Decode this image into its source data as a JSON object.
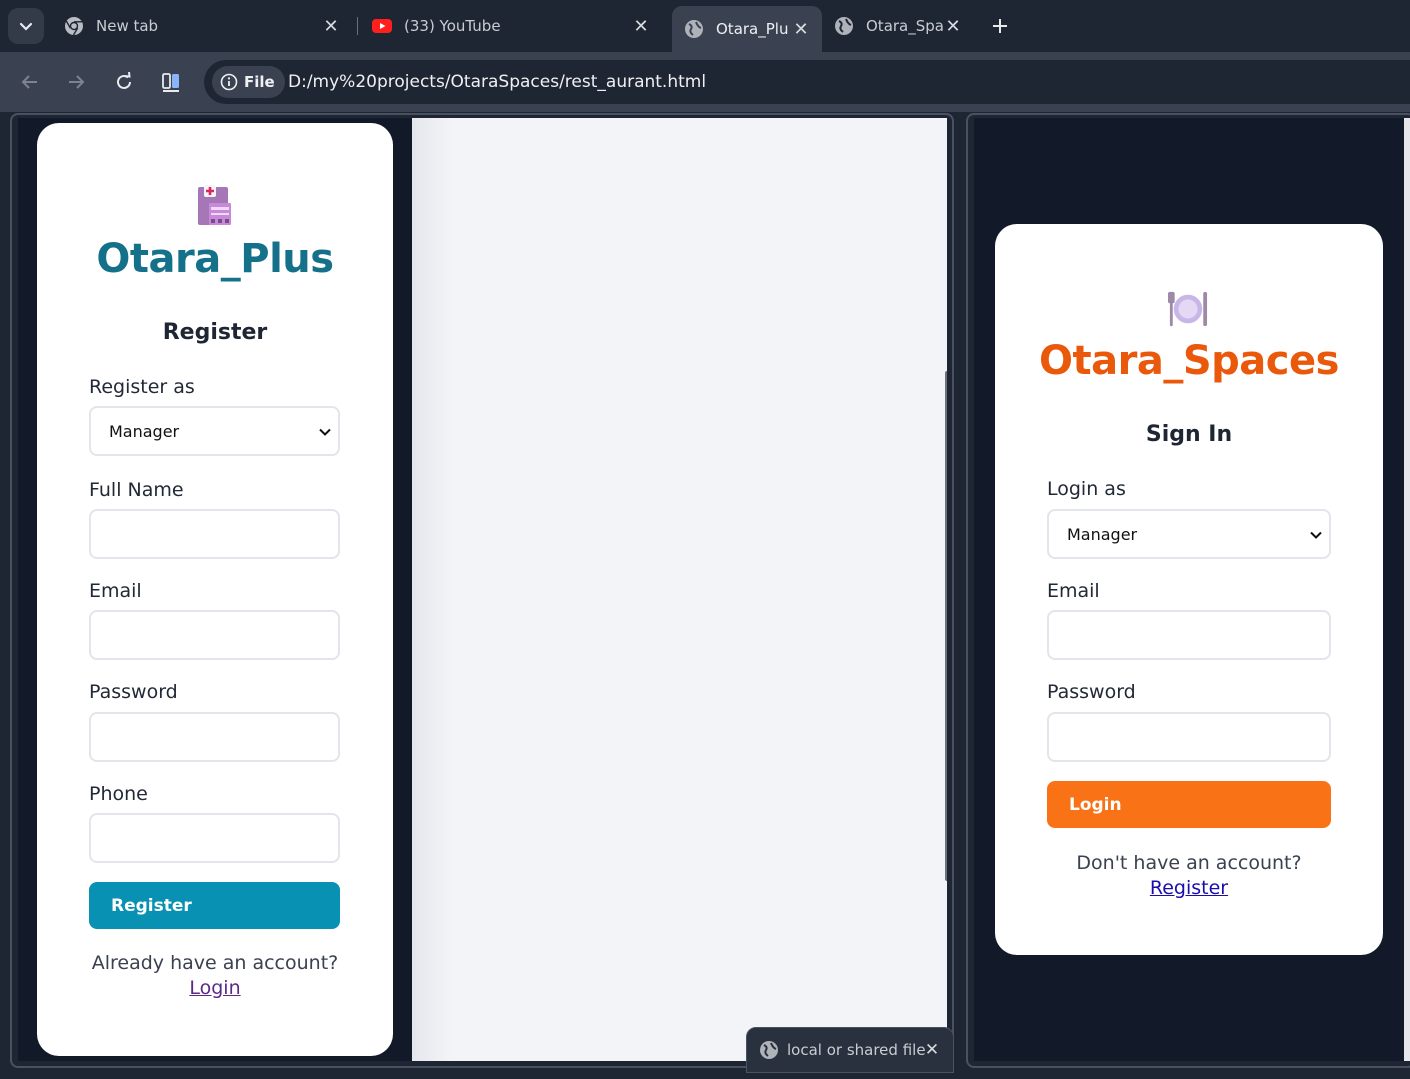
{
  "browser": {
    "tabs": [
      {
        "title": "New tab",
        "icon": "chrome-icon",
        "active": false
      },
      {
        "title": "(33) YouTube",
        "icon": "youtube-icon",
        "active": false
      },
      {
        "title": "Otara_Plu",
        "icon": "globe-icon",
        "active": true
      },
      {
        "title": "Otara_Spa",
        "icon": "globe-icon",
        "active": false
      }
    ],
    "address": {
      "chip_label": "File",
      "url": "D:/my%20projects/OtaraSpaces/rest_aurant.html"
    },
    "status_text": "local or shared file"
  },
  "register_card": {
    "brand": "Otara_Plus",
    "brand_color": "#15718a",
    "heading": "Register",
    "register_as_label": "Register as",
    "register_as_value": "Manager",
    "full_name_label": "Full Name",
    "full_name_value": "",
    "email_label": "Email",
    "email_value": "",
    "password_label": "Password",
    "password_value": "",
    "phone_label": "Phone",
    "phone_value": "",
    "submit_label": "Register",
    "submit_color": "#0891b2",
    "footer_text": "Already have an account?",
    "footer_link": "Login"
  },
  "signin_card": {
    "brand": "Otara_Spaces",
    "brand_color": "#ea580c",
    "heading": "Sign In",
    "login_as_label": "Login as",
    "login_as_value": "Manager",
    "email_label": "Email",
    "email_value": "",
    "password_label": "Password",
    "password_value": "",
    "submit_label": "Login",
    "submit_color": "#f97316",
    "footer_text": "Don't have an account?",
    "footer_link": "Register"
  }
}
